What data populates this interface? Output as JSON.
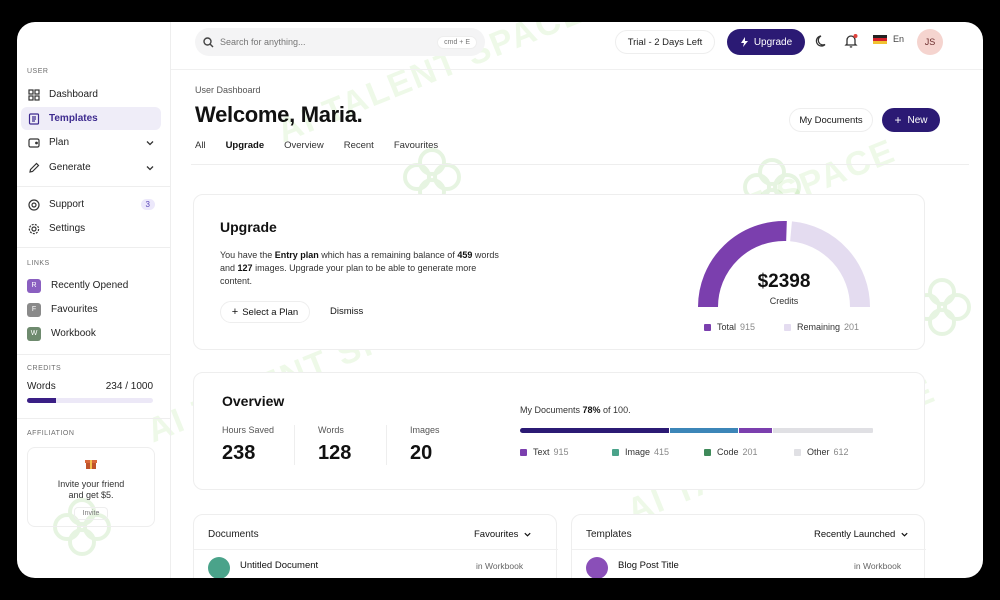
{
  "sidebar": {
    "user_heading": "USER",
    "items": [
      {
        "label": "Dashboard"
      },
      {
        "label": "Templates"
      },
      {
        "label": "Plan"
      },
      {
        "label": "Generate"
      }
    ],
    "support_label": "Support",
    "support_badge": "3",
    "settings_label": "Settings",
    "links_heading": "LINKS",
    "links": [
      {
        "letter": "R",
        "label": "Recently Opened",
        "color": "#8a5fc0"
      },
      {
        "letter": "F",
        "label": "Favourites",
        "color": "#8a8a8a"
      },
      {
        "letter": "W",
        "label": "Workbook",
        "color": "#6e8a6e"
      }
    ],
    "credits_heading": "CREDITS",
    "credits_label": "Words",
    "credits_value": "234 / 1000",
    "credits_fraction": 0.234,
    "affiliation_heading": "AFFILIATION",
    "invite_line1": "Invite your friend",
    "invite_line2": "and get $5.",
    "invite_button": "Invite"
  },
  "topbar": {
    "search_placeholder": "Search for anything...",
    "search_shortcut": "cmd + E",
    "trial_label": "Trial - 2 Days Left",
    "upgrade_label": "Upgrade",
    "language": "En",
    "avatar_initials": "JS"
  },
  "header": {
    "breadcrumb": "User Dashboard",
    "welcome": "Welcome, Maria.",
    "tabs": [
      "All",
      "Upgrade",
      "Overview",
      "Recent",
      "Favourites"
    ],
    "active_tab": "Upgrade",
    "my_documents": "My Documents",
    "new_label": "New"
  },
  "upgrade_card": {
    "title": "Upgrade",
    "desc_1": "You have the ",
    "desc_plan": "Entry plan",
    "desc_2": " which has a remaining balance of ",
    "desc_words": "459",
    "desc_3": " words and ",
    "desc_images": "127",
    "desc_4": " images. Upgrade your plan to be able to generate more content.",
    "select_plan": "Select a Plan",
    "dismiss": "Dismiss",
    "amount": "$2398",
    "amount_label": "Credits",
    "legend": [
      {
        "label": "Total",
        "value": "915",
        "color": "#7b3fae"
      },
      {
        "label": "Remaining",
        "value": "201",
        "color": "#e4dcf0"
      }
    ],
    "gauge_fraction": 0.52
  },
  "overview_card": {
    "title": "Overview",
    "stats": [
      {
        "label": "Hours Saved",
        "value": "238"
      },
      {
        "label": "Words",
        "value": "128"
      },
      {
        "label": "Images",
        "value": "20"
      }
    ],
    "mydocs_prefix": "My Documents ",
    "mydocs_pct": "78%",
    "mydocs_suffix": " of 100.",
    "segments": [
      {
        "label": "Text",
        "value": "915",
        "color": "#2b1a74",
        "legend_color": "#7b3fae"
      },
      {
        "label": "Image",
        "value": "415",
        "color": "#3c86b8",
        "legend_color": "#4aa38a"
      },
      {
        "label": "Code",
        "value": "201",
        "color": "#7b3fae",
        "legend_color": "#3f8a5a"
      },
      {
        "label": "Other",
        "value": "612",
        "color": "#e0e0e4",
        "legend_color": "#e0e0e4"
      }
    ]
  },
  "documents_card": {
    "title": "Documents",
    "filter": "Favourites",
    "row_title": "Untitled Document",
    "row_meta": "in Workbook"
  },
  "templates_card": {
    "title": "Templates",
    "filter": "Recently Launched",
    "row_title": "Blog Post Title",
    "row_meta": "in Workbook"
  },
  "watermark": "AI TALENT SPACE"
}
